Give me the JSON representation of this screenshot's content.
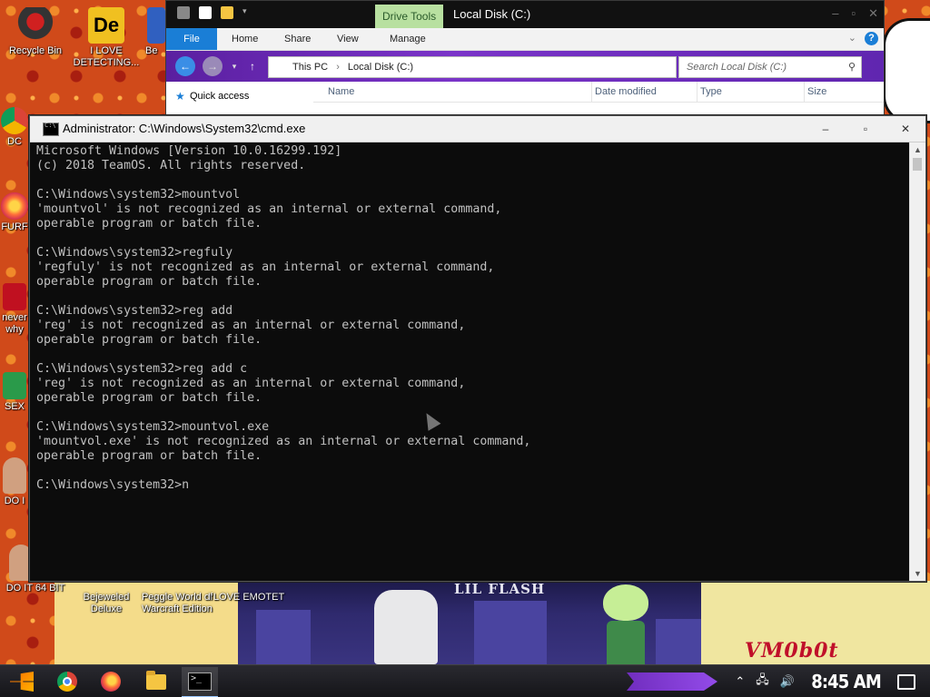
{
  "desktop": {
    "icons": [
      {
        "label": "Recycle Bin",
        "color": "#c0c0c0"
      },
      {
        "label": "I LOVE DETECTING...",
        "color": "#f0c020"
      },
      {
        "label": "Be",
        "color": "#3060c0"
      },
      {
        "label": "DC",
        "color": "#4285f4"
      },
      {
        "label": "FURF",
        "color": "#e04020"
      },
      {
        "label": "never why",
        "color": "#c01020"
      },
      {
        "label": "SEX",
        "color": "#2a9a4a"
      },
      {
        "label": "DO I",
        "color": "#d0a080"
      },
      {
        "label": "DO IT 64 BIT",
        "color": "#d0a080"
      },
      {
        "label": "Bejeweled Deluxe",
        "color": "#8040c0"
      },
      {
        "label": "Peggle World of Warcraft Edition",
        "color": "#2060a0"
      },
      {
        "label": "I LOVE EMOTET",
        "color": "#c04040"
      }
    ],
    "art_title": "LIL FLASH",
    "watermark": "VM0b0t"
  },
  "explorer": {
    "context_tab": "Drive Tools",
    "title": "Local Disk (C:)",
    "ribbon_tabs": [
      "File",
      "Home",
      "Share",
      "View",
      "Manage"
    ],
    "breadcrumb": [
      "This PC",
      "Local Disk (C:)"
    ],
    "search_placeholder": "Search Local Disk (C:)",
    "nav_quick_access": "Quick access",
    "columns": [
      "Name",
      "Date modified",
      "Type",
      "Size"
    ]
  },
  "cmd": {
    "title": "Administrator: C:\\Windows\\System32\\cmd.exe",
    "output": "Microsoft Windows [Version 10.0.16299.192]\n(c) 2018 TeamOS. All rights reserved.\n\nC:\\Windows\\system32>mountvol\n'mountvol' is not recognized as an internal or external command,\noperable program or batch file.\n\nC:\\Windows\\system32>regfuly\n'regfuly' is not recognized as an internal or external command,\noperable program or batch file.\n\nC:\\Windows\\system32>reg add\n'reg' is not recognized as an internal or external command,\noperable program or batch file.\n\nC:\\Windows\\system32>reg add c\n'reg' is not recognized as an internal or external command,\noperable program or batch file.\n\nC:\\Windows\\system32>mountvol.exe\n'mountvol.exe' is not recognized as an internal or external command,\noperable program or batch file.\n\nC:\\Windows\\system32>n",
    "controls": [
      "–",
      "▫",
      "✕"
    ]
  },
  "taskbar": {
    "apps": [
      "start-icon",
      "chrome-icon",
      "firefox-icon",
      "file-explorer-icon",
      "cmd-icon"
    ],
    "active_app": "cmd-icon",
    "clock": "8:45 AM"
  }
}
